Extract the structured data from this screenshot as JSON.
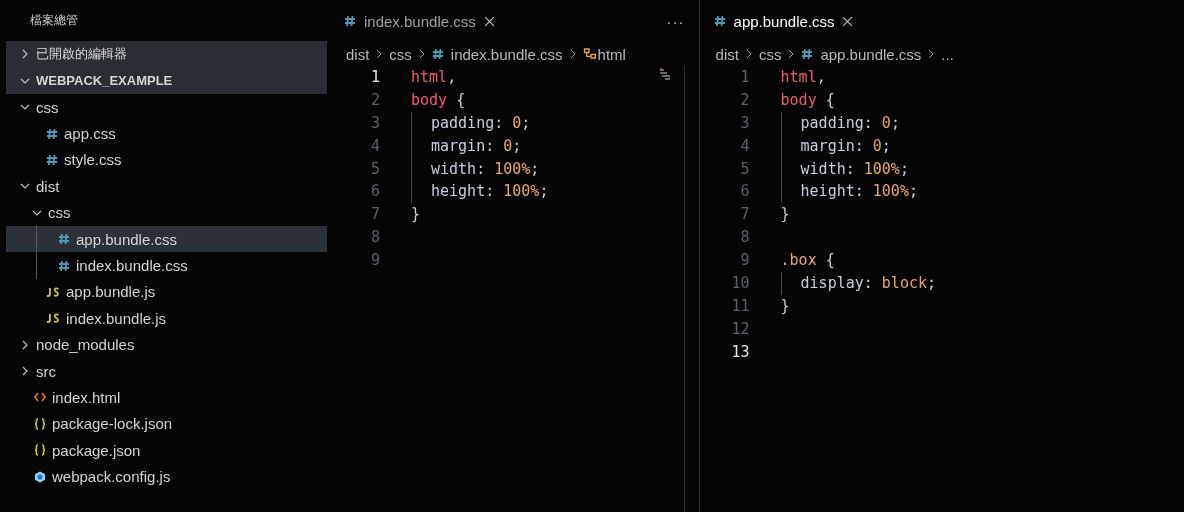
{
  "explorer": {
    "title": "檔案總管",
    "sections": [
      {
        "label": "已開啟的編輯器",
        "expanded": false
      },
      {
        "label": "WEBPACK_EXAMPLE",
        "expanded": true
      }
    ],
    "tree": [
      {
        "label": "css",
        "kind": "folder",
        "expanded": true,
        "selected": false,
        "children": [
          {
            "label": "app.css",
            "kind": "css",
            "selected": false
          },
          {
            "label": "style.css",
            "kind": "css",
            "selected": false
          }
        ]
      },
      {
        "label": "dist",
        "kind": "folder",
        "expanded": true,
        "selected": false,
        "children": [
          {
            "label": "css",
            "kind": "folder",
            "expanded": true,
            "selected": false,
            "children": [
              {
                "label": "app.bundle.css",
                "kind": "css",
                "selected": true
              },
              {
                "label": "index.bundle.css",
                "kind": "css",
                "selected": false
              }
            ]
          },
          {
            "label": "app.bundle.js",
            "kind": "js",
            "selected": false
          },
          {
            "label": "index.bundle.js",
            "kind": "js",
            "selected": false
          }
        ]
      },
      {
        "label": "node_modules",
        "kind": "folder",
        "expanded": false,
        "selected": false
      },
      {
        "label": "src",
        "kind": "folder",
        "expanded": false,
        "selected": false
      },
      {
        "label": "index.html",
        "kind": "html",
        "selected": false
      },
      {
        "label": "package-lock.json",
        "kind": "json",
        "selected": false
      },
      {
        "label": "package.json",
        "kind": "json",
        "selected": false
      },
      {
        "label": "webpack.config.js",
        "kind": "webpack",
        "selected": false
      }
    ]
  },
  "editors": [
    {
      "tab": {
        "label": "index.bundle.css",
        "selected": false
      },
      "actions": "···",
      "breadcrumbs": [
        {
          "kind": "folder",
          "text": "dist"
        },
        {
          "kind": "folder",
          "text": "css"
        },
        {
          "kind": "file",
          "text": "index.bundle.css"
        },
        {
          "kind": "symbol",
          "text": "html"
        }
      ],
      "lines": [
        {
          "number": "1",
          "active": true,
          "guide": false,
          "tokens": [
            {
              "kind": "selector",
              "text": "html"
            },
            {
              "kind": "punct",
              "text": ","
            }
          ]
        },
        {
          "number": "2",
          "active": false,
          "guide": false,
          "tokens": [
            {
              "kind": "selector",
              "text": "body"
            },
            {
              "kind": "punct",
              "text": " {"
            }
          ]
        },
        {
          "number": "3",
          "active": false,
          "guide": true,
          "tokens": [
            {
              "kind": "property",
              "text": "padding: "
            },
            {
              "kind": "value",
              "text": "0"
            },
            {
              "kind": "punct",
              "text": ";"
            }
          ]
        },
        {
          "number": "4",
          "active": false,
          "guide": true,
          "tokens": [
            {
              "kind": "property",
              "text": "margin: "
            },
            {
              "kind": "value",
              "text": "0"
            },
            {
              "kind": "punct",
              "text": ";"
            }
          ]
        },
        {
          "number": "5",
          "active": false,
          "guide": true,
          "tokens": [
            {
              "kind": "property",
              "text": "width: "
            },
            {
              "kind": "value",
              "text": "100%"
            },
            {
              "kind": "punct",
              "text": ";"
            }
          ]
        },
        {
          "number": "6",
          "active": false,
          "guide": true,
          "tokens": [
            {
              "kind": "property",
              "text": "height: "
            },
            {
              "kind": "value",
              "text": "100%"
            },
            {
              "kind": "punct",
              "text": ";"
            }
          ]
        },
        {
          "number": "7",
          "active": false,
          "guide": false,
          "tokens": [
            {
              "kind": "punct",
              "text": "}"
            }
          ]
        },
        {
          "number": "8",
          "active": false,
          "guide": false
        },
        {
          "number": "9",
          "active": false,
          "guide": false
        }
      ]
    },
    {
      "tab": {
        "label": "app.bundle.css",
        "selected": true
      },
      "breadcrumbs": [
        {
          "kind": "folder",
          "text": "dist"
        },
        {
          "kind": "folder",
          "text": "css"
        },
        {
          "kind": "file",
          "text": "app.bundle.css"
        },
        {
          "kind": "ellipsis",
          "text": "..."
        }
      ],
      "lines": [
        {
          "number": "1",
          "active": false,
          "guide": false,
          "tokens": [
            {
              "kind": "selector",
              "text": "html"
            },
            {
              "kind": "punct",
              "text": ","
            }
          ]
        },
        {
          "number": "2",
          "active": false,
          "guide": false,
          "tokens": [
            {
              "kind": "selector",
              "text": "body"
            },
            {
              "kind": "punct",
              "text": " {"
            }
          ]
        },
        {
          "number": "3",
          "active": false,
          "guide": true,
          "tokens": [
            {
              "kind": "property",
              "text": "padding: "
            },
            {
              "kind": "value",
              "text": "0"
            },
            {
              "kind": "punct",
              "text": ";"
            }
          ]
        },
        {
          "number": "4",
          "active": false,
          "guide": true,
          "tokens": [
            {
              "kind": "property",
              "text": "margin: "
            },
            {
              "kind": "value",
              "text": "0"
            },
            {
              "kind": "punct",
              "text": ";"
            }
          ]
        },
        {
          "number": "5",
          "active": false,
          "guide": true,
          "tokens": [
            {
              "kind": "property",
              "text": "width: "
            },
            {
              "kind": "value",
              "text": "100%"
            },
            {
              "kind": "punct",
              "text": ";"
            }
          ]
        },
        {
          "number": "6",
          "active": false,
          "guide": true,
          "tokens": [
            {
              "kind": "property",
              "text": "height: "
            },
            {
              "kind": "value",
              "text": "100%"
            },
            {
              "kind": "punct",
              "text": ";"
            }
          ]
        },
        {
          "number": "7",
          "active": false,
          "guide": false,
          "tokens": [
            {
              "kind": "punct",
              "text": "}"
            }
          ]
        },
        {
          "number": "8",
          "active": false,
          "guide": false
        },
        {
          "number": "9",
          "active": false,
          "guide": false,
          "tokens": [
            {
              "kind": "value",
              "text": ".box"
            },
            {
              "kind": "punct",
              "text": " {"
            }
          ]
        },
        {
          "number": "10",
          "active": false,
          "guide": true,
          "tokens": [
            {
              "kind": "property",
              "text": "display: "
            },
            {
              "kind": "value",
              "text": "block"
            },
            {
              "kind": "punct",
              "text": ";"
            }
          ]
        },
        {
          "number": "11",
          "active": false,
          "guide": false,
          "tokens": [
            {
              "kind": "punct",
              "text": "}"
            }
          ]
        },
        {
          "number": "12",
          "active": false,
          "guide": false
        },
        {
          "number": "13",
          "active": true,
          "guide": false
        }
      ]
    }
  ]
}
